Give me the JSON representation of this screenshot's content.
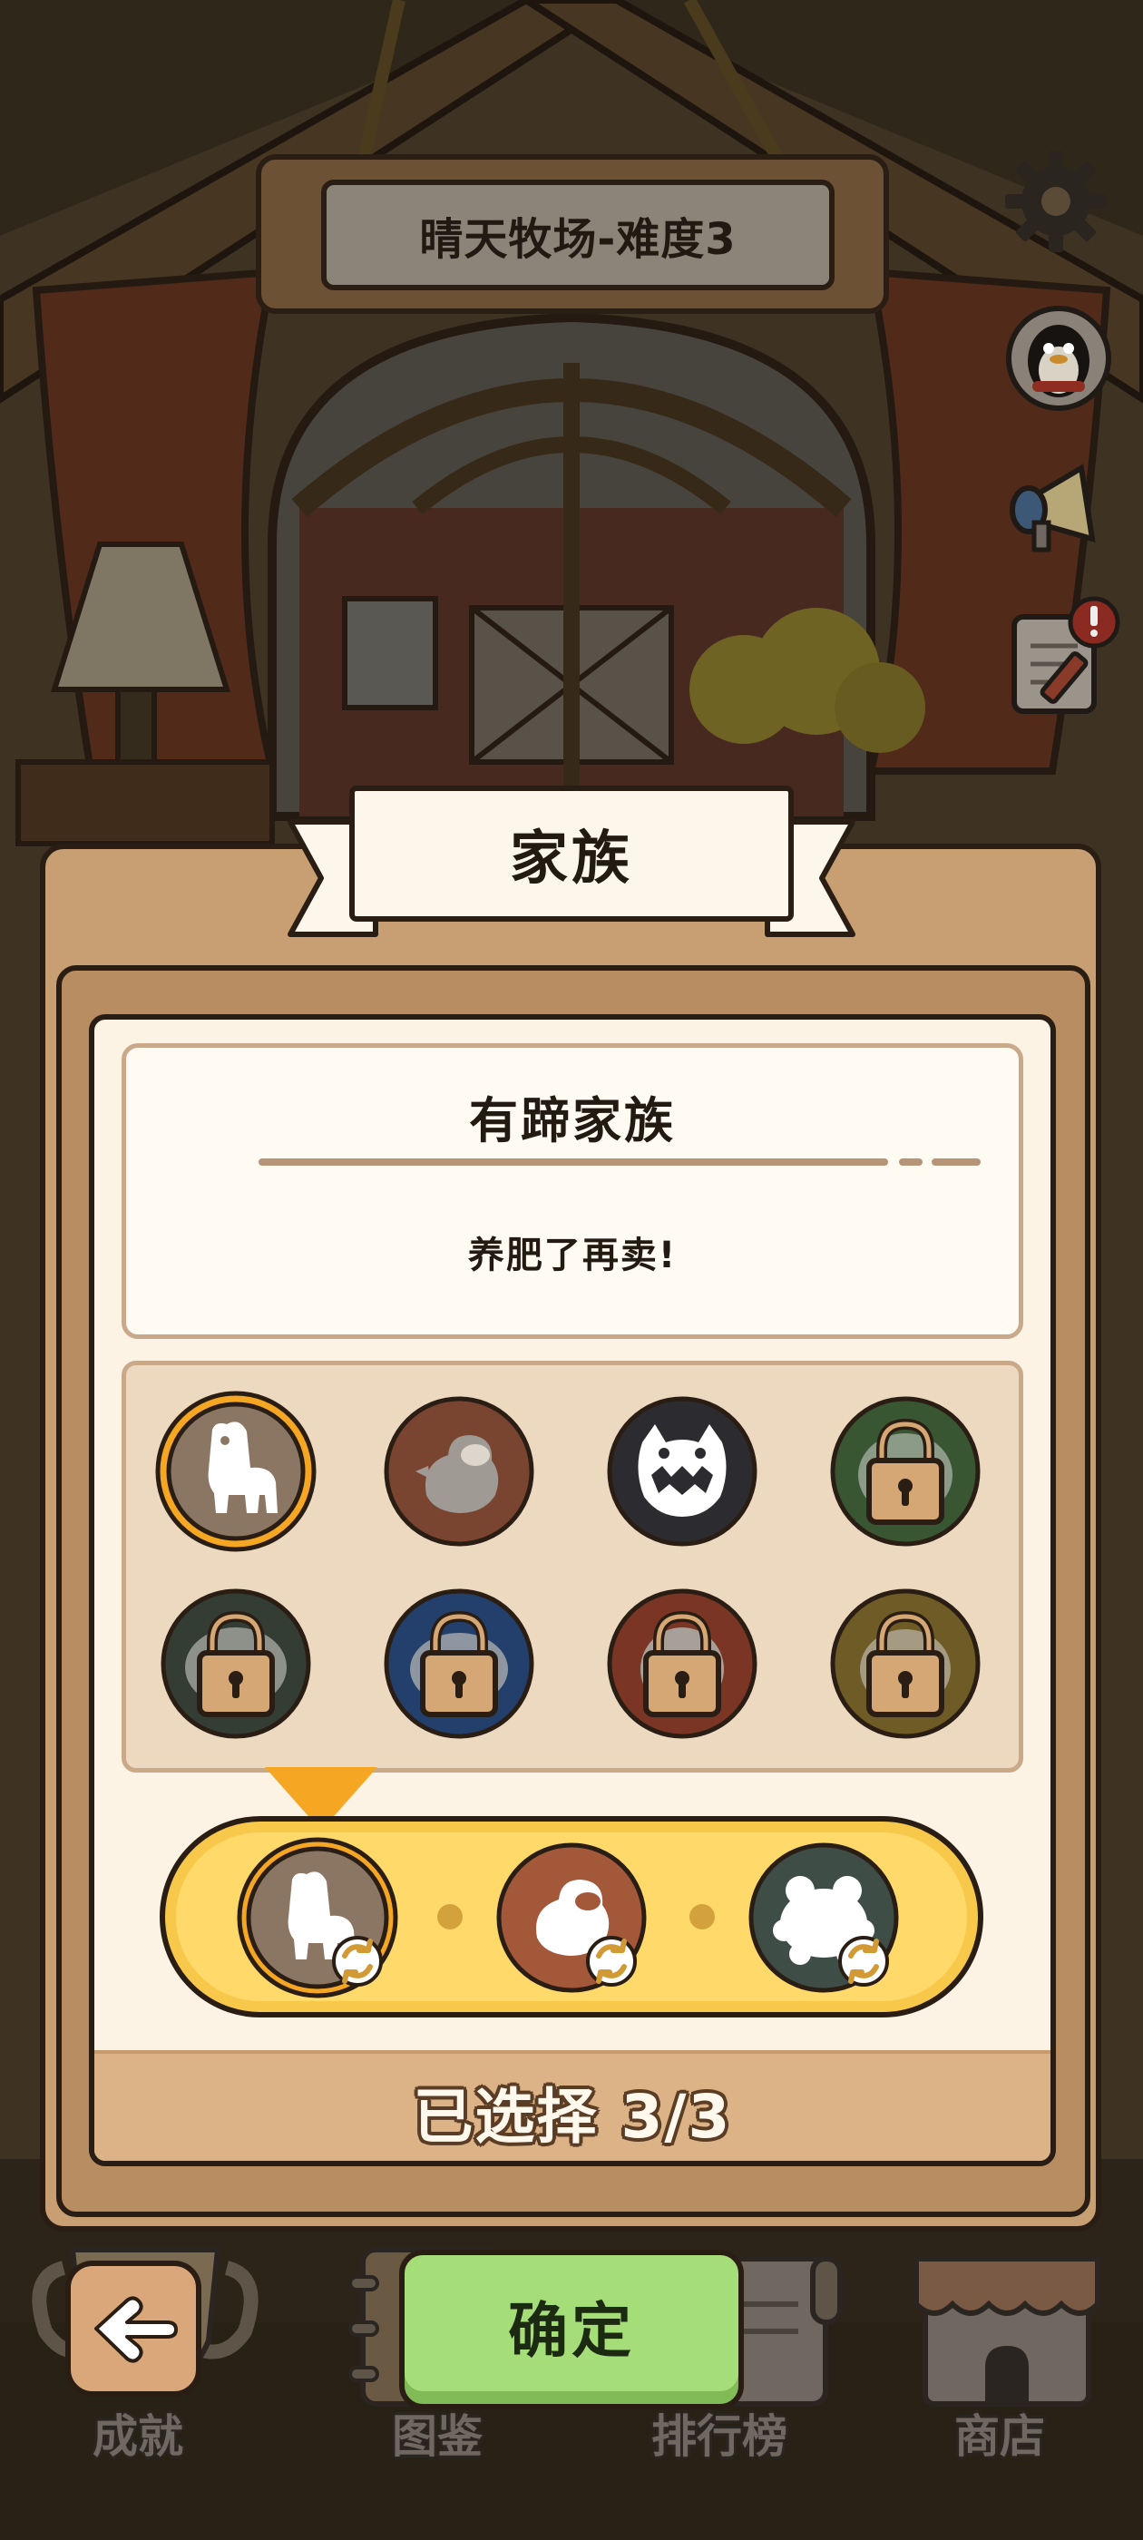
{
  "header": {
    "level_title": "晴天牧场-难度3"
  },
  "side_icons": [
    "gear-icon",
    "penguin-avatar-icon",
    "megaphone-icon",
    "notepad-alert-icon"
  ],
  "panel": {
    "title": "家族",
    "family_name": "有蹄家族",
    "family_description": "养肥了再卖!",
    "selected_count": "已选择 3/3"
  },
  "families": [
    {
      "id": "hoofed",
      "icon": "alpaca-silhouette-icon",
      "bg": "#8b7664",
      "locked": false,
      "selected": true
    },
    {
      "id": "bird",
      "icon": "bird-silhouette-icon",
      "bg": "#7a4530",
      "locked": false,
      "selected": false
    },
    {
      "id": "monster",
      "icon": "monster-silhouette-icon",
      "bg": "#2c2c30",
      "locked": false,
      "selected": false
    },
    {
      "id": "green",
      "icon": "lock-icon",
      "bg": "#385632",
      "locked": true,
      "selected": false
    },
    {
      "id": "darkgreen",
      "icon": "lock-icon",
      "bg": "#333d34",
      "locked": true,
      "selected": false
    },
    {
      "id": "blue",
      "icon": "lock-icon",
      "bg": "#233f6c",
      "locked": true,
      "selected": false
    },
    {
      "id": "red",
      "icon": "lock-icon",
      "bg": "#7a3524",
      "locked": true,
      "selected": false
    },
    {
      "id": "olive",
      "icon": "lock-icon",
      "bg": "#6e5b25",
      "locked": true,
      "selected": false
    }
  ],
  "selected_slots": [
    {
      "icon": "alpaca-silhouette-icon",
      "bg": "#8b7664"
    },
    {
      "icon": "bird-silhouette-icon",
      "bg": "#a4583a"
    },
    {
      "icon": "frog-silhouette-icon",
      "bg": "#3e4e46"
    }
  ],
  "buttons": {
    "confirm": "确定"
  },
  "bottom_nav": [
    {
      "label": "成就"
    },
    {
      "label": "图鉴"
    },
    {
      "label": "排行榜"
    },
    {
      "label": "商店"
    }
  ],
  "colors": {
    "outline": "#2a1e14",
    "panel": "#c79f72",
    "card": "#fdf3e5",
    "selected_ring": "#f5a623",
    "confirm": "#a5dd78",
    "slot_bar": "#f8c84a"
  }
}
